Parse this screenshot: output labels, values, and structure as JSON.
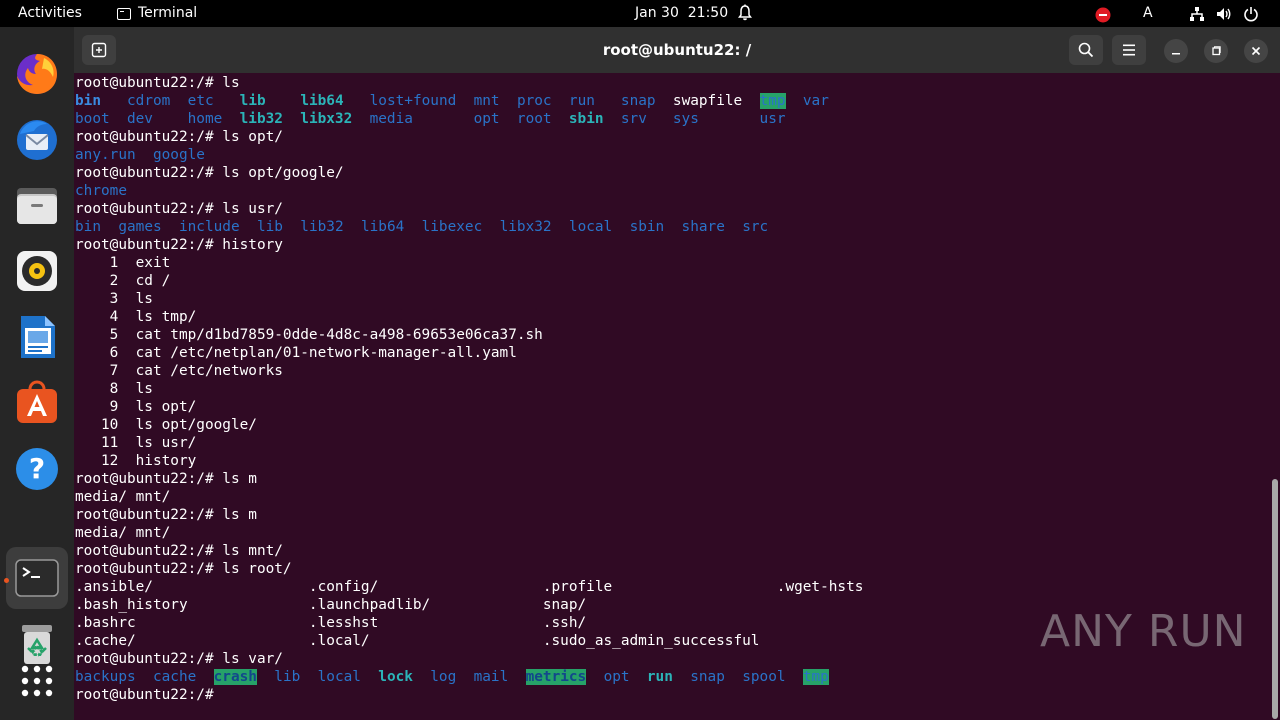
{
  "topbar": {
    "activities": "Activities",
    "app_name": "Terminal",
    "date": "Jan 30",
    "time": "21:50",
    "input_method": "A"
  },
  "dock": {
    "items": [
      {
        "name": "firefox-icon"
      },
      {
        "name": "thunderbird-icon"
      },
      {
        "name": "files-icon"
      },
      {
        "name": "rhythmbox-icon"
      },
      {
        "name": "libreoffice-writer-icon"
      },
      {
        "name": "app-center-icon"
      },
      {
        "name": "help-icon"
      },
      {
        "name": "terminal-icon"
      },
      {
        "name": "trash-icon"
      },
      {
        "name": "show-apps-icon"
      }
    ]
  },
  "window": {
    "title": "root@ubuntu22: /"
  },
  "terminal": {
    "lines": [
      [
        {
          "t": "root@ubuntu22:/# ls",
          "c": "norm"
        }
      ],
      [
        {
          "t": "bin",
          "c": "bold"
        },
        {
          "t": "   ",
          "c": "norm"
        },
        {
          "t": "cdrom",
          "c": "dir"
        },
        {
          "t": "  ",
          "c": "norm"
        },
        {
          "t": "etc",
          "c": "dir"
        },
        {
          "t": "   ",
          "c": "norm"
        },
        {
          "t": "lib",
          "c": "link"
        },
        {
          "t": "    ",
          "c": "norm"
        },
        {
          "t": "lib64",
          "c": "link"
        },
        {
          "t": "   ",
          "c": "norm"
        },
        {
          "t": "lost+found",
          "c": "dir"
        },
        {
          "t": "  ",
          "c": "norm"
        },
        {
          "t": "mnt",
          "c": "dir"
        },
        {
          "t": "  ",
          "c": "norm"
        },
        {
          "t": "proc",
          "c": "dir"
        },
        {
          "t": "  ",
          "c": "norm"
        },
        {
          "t": "run",
          "c": "dir"
        },
        {
          "t": "   ",
          "c": "norm"
        },
        {
          "t": "snap",
          "c": "dir"
        },
        {
          "t": "  ",
          "c": "norm"
        },
        {
          "t": "swapfile",
          "c": "norm"
        },
        {
          "t": "  ",
          "c": "norm"
        },
        {
          "t": "tmp",
          "c": "hl"
        },
        {
          "t": "  ",
          "c": "norm"
        },
        {
          "t": "var",
          "c": "dir"
        }
      ],
      [
        {
          "t": "boot",
          "c": "dir"
        },
        {
          "t": "  ",
          "c": "norm"
        },
        {
          "t": "dev",
          "c": "dir"
        },
        {
          "t": "    ",
          "c": "norm"
        },
        {
          "t": "home",
          "c": "dir"
        },
        {
          "t": "  ",
          "c": "norm"
        },
        {
          "t": "lib32",
          "c": "link"
        },
        {
          "t": "  ",
          "c": "norm"
        },
        {
          "t": "libx32",
          "c": "link"
        },
        {
          "t": "  ",
          "c": "norm"
        },
        {
          "t": "media",
          "c": "dir"
        },
        {
          "t": "       ",
          "c": "norm"
        },
        {
          "t": "opt",
          "c": "dir"
        },
        {
          "t": "  ",
          "c": "norm"
        },
        {
          "t": "root",
          "c": "dir"
        },
        {
          "t": "  ",
          "c": "norm"
        },
        {
          "t": "sbin",
          "c": "link"
        },
        {
          "t": "  ",
          "c": "norm"
        },
        {
          "t": "srv",
          "c": "dir"
        },
        {
          "t": "   ",
          "c": "norm"
        },
        {
          "t": "sys",
          "c": "dir"
        },
        {
          "t": "       ",
          "c": "norm"
        },
        {
          "t": "usr",
          "c": "dir"
        }
      ],
      [
        {
          "t": "root@ubuntu22:/# ls opt/",
          "c": "norm"
        }
      ],
      [
        {
          "t": "any.run",
          "c": "dir"
        },
        {
          "t": "  ",
          "c": "norm"
        },
        {
          "t": "google",
          "c": "dir"
        }
      ],
      [
        {
          "t": "root@ubuntu22:/# ls opt/google/",
          "c": "norm"
        }
      ],
      [
        {
          "t": "chrome",
          "c": "dir"
        }
      ],
      [
        {
          "t": "root@ubuntu22:/# ls usr/",
          "c": "norm"
        }
      ],
      [
        {
          "t": "bin",
          "c": "dir"
        },
        {
          "t": "  ",
          "c": "norm"
        },
        {
          "t": "games",
          "c": "dir"
        },
        {
          "t": "  ",
          "c": "norm"
        },
        {
          "t": "include",
          "c": "dir"
        },
        {
          "t": "  ",
          "c": "norm"
        },
        {
          "t": "lib",
          "c": "dir"
        },
        {
          "t": "  ",
          "c": "norm"
        },
        {
          "t": "lib32",
          "c": "dir"
        },
        {
          "t": "  ",
          "c": "norm"
        },
        {
          "t": "lib64",
          "c": "dir"
        },
        {
          "t": "  ",
          "c": "norm"
        },
        {
          "t": "libexec",
          "c": "dir"
        },
        {
          "t": "  ",
          "c": "norm"
        },
        {
          "t": "libx32",
          "c": "dir"
        },
        {
          "t": "  ",
          "c": "norm"
        },
        {
          "t": "local",
          "c": "dir"
        },
        {
          "t": "  ",
          "c": "norm"
        },
        {
          "t": "sbin",
          "c": "dir"
        },
        {
          "t": "  ",
          "c": "norm"
        },
        {
          "t": "share",
          "c": "dir"
        },
        {
          "t": "  ",
          "c": "norm"
        },
        {
          "t": "src",
          "c": "dir"
        }
      ],
      [
        {
          "t": "root@ubuntu22:/# history",
          "c": "norm"
        }
      ],
      [
        {
          "t": "    1  exit",
          "c": "norm"
        }
      ],
      [
        {
          "t": "    2  cd /",
          "c": "norm"
        }
      ],
      [
        {
          "t": "    3  ls",
          "c": "norm"
        }
      ],
      [
        {
          "t": "    4  ls tmp/",
          "c": "norm"
        }
      ],
      [
        {
          "t": "    5  cat tmp/d1bd7859-0dde-4d8c-a498-69653e06ca37.sh",
          "c": "norm"
        }
      ],
      [
        {
          "t": "    6  cat /etc/netplan/01-network-manager-all.yaml",
          "c": "norm"
        }
      ],
      [
        {
          "t": "    7  cat /etc/networks",
          "c": "norm"
        }
      ],
      [
        {
          "t": "    8  ls",
          "c": "norm"
        }
      ],
      [
        {
          "t": "    9  ls opt/",
          "c": "norm"
        }
      ],
      [
        {
          "t": "   10  ls opt/google/",
          "c": "norm"
        }
      ],
      [
        {
          "t": "   11  ls usr/",
          "c": "norm"
        }
      ],
      [
        {
          "t": "   12  history",
          "c": "norm"
        }
      ],
      [
        {
          "t": "root@ubuntu22:/# ls m",
          "c": "norm"
        }
      ],
      [
        {
          "t": "media/ mnt/",
          "c": "norm"
        }
      ],
      [
        {
          "t": "root@ubuntu22:/# ls m",
          "c": "norm"
        }
      ],
      [
        {
          "t": "media/ mnt/",
          "c": "norm"
        }
      ],
      [
        {
          "t": "root@ubuntu22:/# ls mnt/",
          "c": "norm"
        }
      ],
      [
        {
          "t": "root@ubuntu22:/# ls root/",
          "c": "norm"
        }
      ],
      [
        {
          "t": ".ansible/                  .config/                   .profile                   .wget-hsts",
          "c": "norm"
        }
      ],
      [
        {
          "t": ".bash_history              .launchpadlib/             snap/",
          "c": "norm"
        }
      ],
      [
        {
          "t": ".bashrc                    .lesshst                   .ssh/",
          "c": "norm"
        }
      ],
      [
        {
          "t": ".cache/                    .local/                    .sudo_as_admin_successful",
          "c": "norm"
        }
      ],
      [
        {
          "t": "root@ubuntu22:/# ls var/",
          "c": "norm"
        }
      ],
      [
        {
          "t": "backups",
          "c": "dir"
        },
        {
          "t": "  ",
          "c": "norm"
        },
        {
          "t": "cache",
          "c": "dir"
        },
        {
          "t": "  ",
          "c": "norm"
        },
        {
          "t": "crash",
          "c": "hl-bold"
        },
        {
          "t": "  ",
          "c": "norm"
        },
        {
          "t": "lib",
          "c": "dir"
        },
        {
          "t": "  ",
          "c": "norm"
        },
        {
          "t": "local",
          "c": "dir"
        },
        {
          "t": "  ",
          "c": "norm"
        },
        {
          "t": "lock",
          "c": "link"
        },
        {
          "t": "  ",
          "c": "norm"
        },
        {
          "t": "log",
          "c": "dir"
        },
        {
          "t": "  ",
          "c": "norm"
        },
        {
          "t": "mail",
          "c": "dir"
        },
        {
          "t": "  ",
          "c": "norm"
        },
        {
          "t": "metrics",
          "c": "hl-bold"
        },
        {
          "t": "  ",
          "c": "norm"
        },
        {
          "t": "opt",
          "c": "dir"
        },
        {
          "t": "  ",
          "c": "norm"
        },
        {
          "t": "run",
          "c": "link"
        },
        {
          "t": "  ",
          "c": "norm"
        },
        {
          "t": "snap",
          "c": "dir"
        },
        {
          "t": "  ",
          "c": "norm"
        },
        {
          "t": "spool",
          "c": "dir"
        },
        {
          "t": "  ",
          "c": "norm"
        },
        {
          "t": "tmp",
          "c": "hl"
        }
      ],
      [
        {
          "t": "root@ubuntu22:/#",
          "c": "norm"
        }
      ]
    ]
  },
  "watermark": "ANY RUN",
  "colors": {
    "terminal_bg": "#300a24",
    "dir_blue": "#2a73c8",
    "link_cyan": "#2bb4b8",
    "highlight_green": "#26a269",
    "accent_orange": "#e95420"
  }
}
